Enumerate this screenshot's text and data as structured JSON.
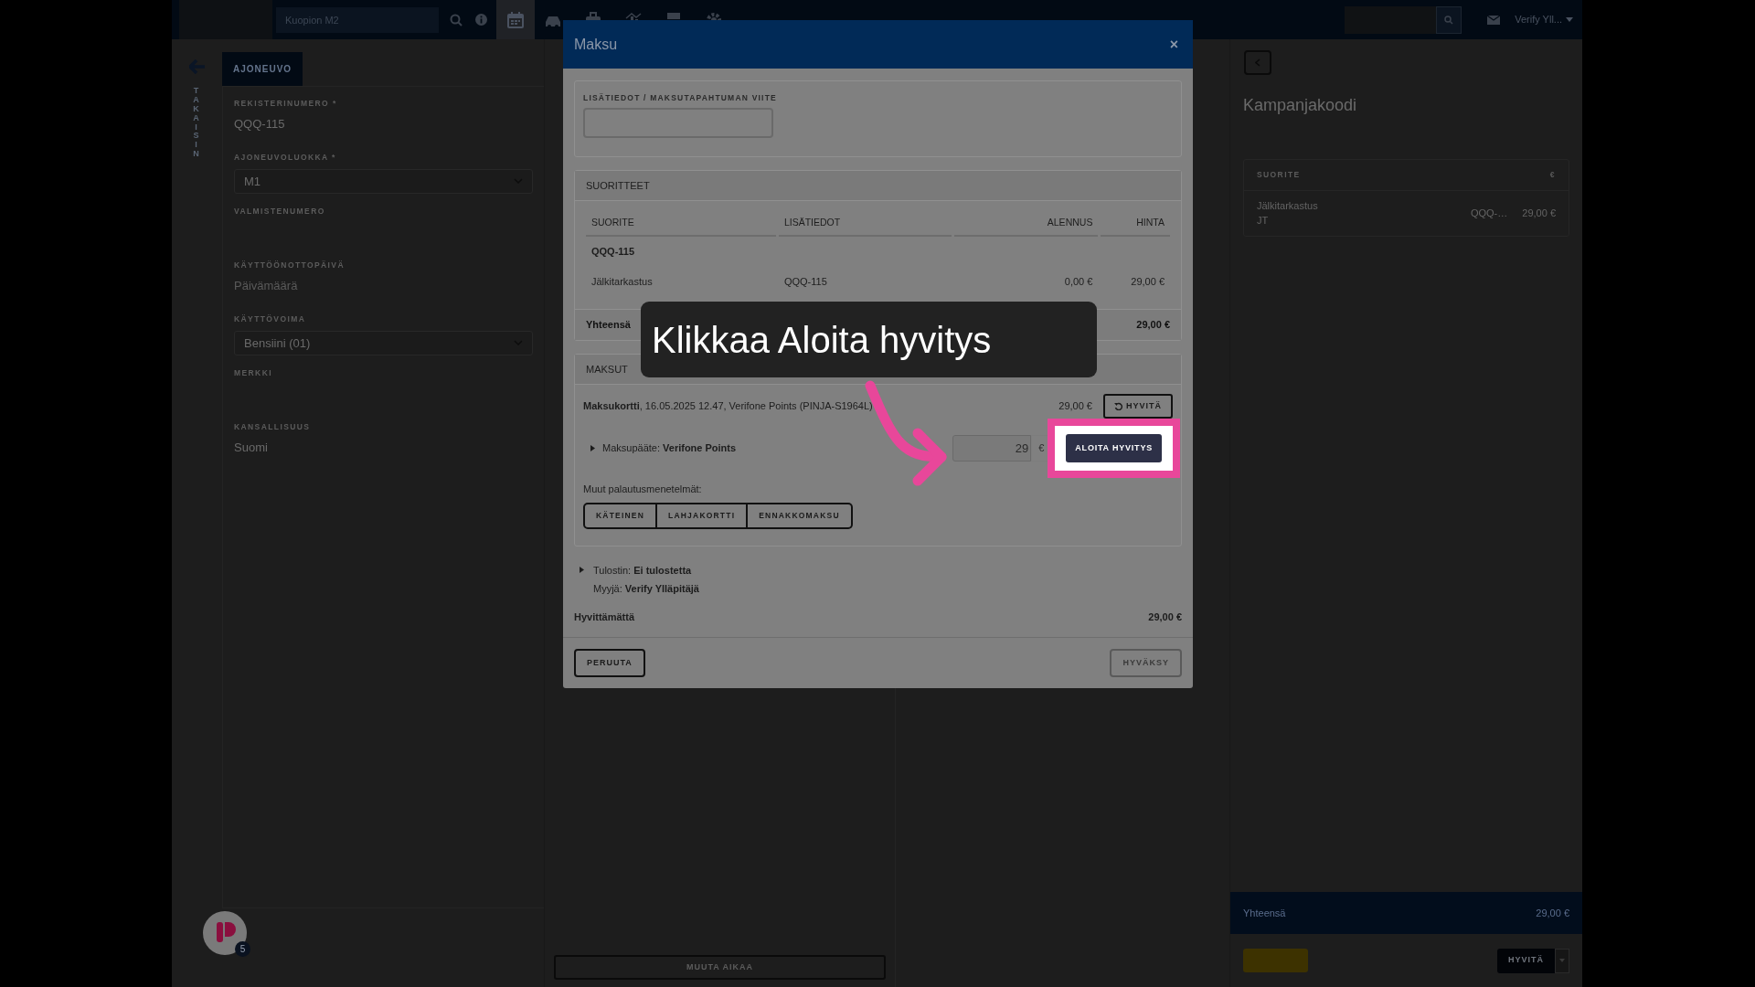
{
  "topbar": {
    "search_value": "Kuopion M2",
    "user": "Verify Yll..."
  },
  "sidebar": {
    "back_label": "TAKAISIN"
  },
  "vehicle": {
    "tab": "AJONEUVO",
    "fields": [
      {
        "label": "REKISTERINUMERO *",
        "kind": "text",
        "value": "QQQ-115"
      },
      {
        "label": "AJONEUVOLUOKKA *",
        "kind": "select",
        "value": "M1"
      },
      {
        "label": "VALMISTENUMERO",
        "kind": "text"
      },
      {
        "label": "KÄYTTÖÖNOTTOPÄIVÄ",
        "kind": "text",
        "placeholder": "Päivämäärä"
      },
      {
        "label": "KÄYTTÖVOIMA",
        "kind": "select",
        "value": "Bensiini (01)"
      },
      {
        "label": "MERKKI",
        "kind": "text"
      },
      {
        "label": "KANSALLISUUS",
        "kind": "text",
        "value": "Suomi"
      }
    ]
  },
  "schedule": {
    "change_time_button": "MUUTA AIKAA"
  },
  "cart": {
    "title": "Kampanjakoodi",
    "columns": [
      "SUORITE",
      "€"
    ],
    "rows": [
      {
        "name": "Jälkitarkastus",
        "code": "JT",
        "plate": "QQQ-…",
        "price": "29,00 €"
      }
    ],
    "total_label": "Yhteensä",
    "total": "29,00 €",
    "refund_button": "HYVITÄ"
  },
  "chat": {
    "badge": "5"
  },
  "modal": {
    "title": "Maksu",
    "close": "×",
    "reference_label": "LISÄTIEDOT / MAKSUTAPAHTUMAN VIITE",
    "items": {
      "header": "SUORITTEET",
      "columns": [
        "SUORITE",
        "LISÄTIEDOT",
        "ALENNUS",
        "HINTA"
      ],
      "groups": [
        {
          "title": "QQQ-115",
          "rows": [
            [
              "Jälkitarkastus",
              "QQQ-115",
              "0,00 €",
              "29,00 €"
            ]
          ]
        }
      ],
      "total_label": "Yhteensä",
      "total": "29,00 €"
    },
    "payments": {
      "header": "MAKSUT",
      "entries": [
        {
          "description": "**Maksukortti**, 16.05.2025 12.47, Verifone Points (PINJA-S1964L)",
          "amount": "29,00 €",
          "refund_button": "HYVITÄ",
          "terminal": "Maksupääte: **Verifone Points**",
          "refund_amount": "29",
          "currency": "€",
          "start_button": "ALOITA HYVITYS",
          "highlighted": true
        }
      ],
      "other_label": "Muut palautusmenetelmät:",
      "other_methods": [
        "KÄTEINEN",
        "LAHJAKORTTI",
        "ENNAKKOMAKSU"
      ]
    },
    "printer": "Tulostin: **Ei tulostetta**",
    "seller": "Myyjä: **Verify Ylläpitäjä**",
    "unrefunded_label": "Hyvittämättä",
    "unrefunded": "29,00 €",
    "cancel_button": "PERUUTA",
    "accept_button": "HYVÄKSY",
    "accept_disabled": true
  },
  "tutorial": {
    "callout": "Klikkaa Aloita hyvitys"
  }
}
